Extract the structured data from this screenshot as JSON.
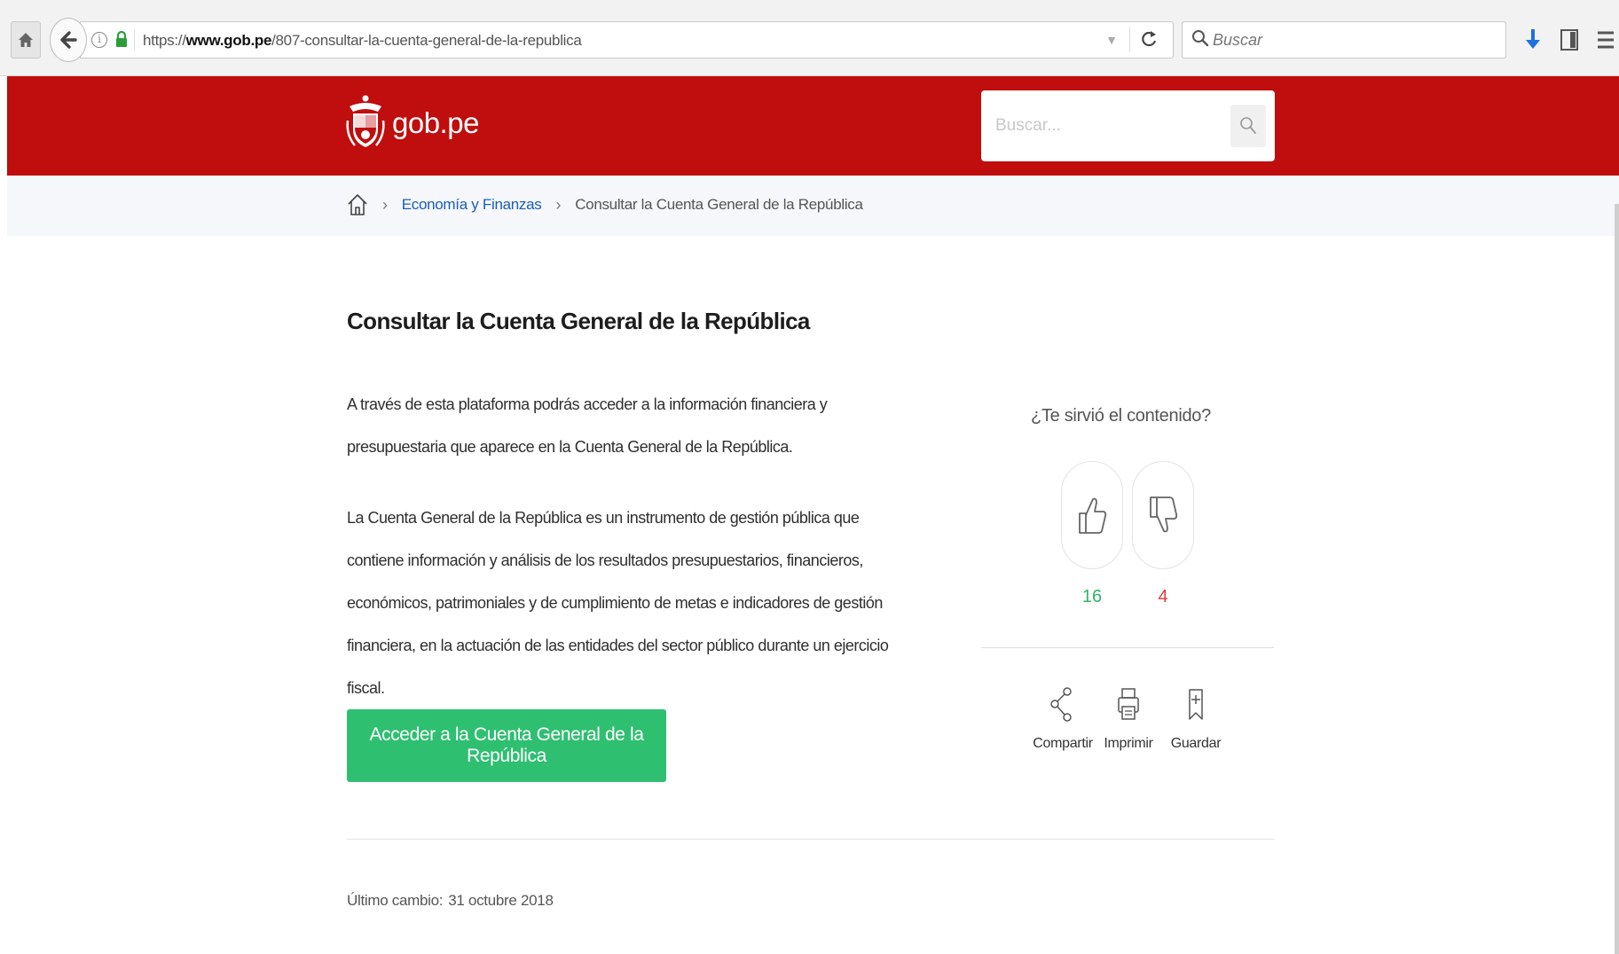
{
  "browser": {
    "url_prefix": "https://",
    "url_domain": "www.gob.pe",
    "url_path": "/807-consultar-la-cuenta-general-de-la-republica",
    "search_placeholder": "Buscar"
  },
  "header": {
    "logo_text": "gob.pe",
    "search_placeholder": "Buscar..."
  },
  "breadcrumb": {
    "link": "Economía y Finanzas",
    "current": "Consultar la Cuenta General de la República"
  },
  "main": {
    "title": "Consultar la Cuenta General de la República",
    "paragraph1": "A través de esta plataforma podrás acceder a la información financiera y presupuestaria que aparece en la Cuenta General de la República.",
    "paragraph2": "La Cuenta General de la República es un instrumento de gestión pública que contiene información y análisis de los resultados presupuestarios, financieros, económicos, patrimoniales y de cumplimiento de metas e indicadores de gestión financiera, en la actuación de las entidades del sector público durante un ejercicio fiscal.",
    "cta_label": "Acceder a la Cuenta General de la República",
    "last_change_label": "Último cambio:",
    "last_change_date": "31 octubre 2018"
  },
  "feedback": {
    "question": "¿Te sirvió el contenido?",
    "up_count": "16",
    "down_count": "4"
  },
  "actions": {
    "share": "Compartir",
    "print": "Imprimir",
    "save": "Guardar"
  },
  "colors": {
    "header_red": "#c00d0d",
    "cta_green": "#2fbf71",
    "link_blue": "#1a5fb4",
    "up_green": "#2fb36a",
    "down_red": "#d93b3b"
  },
  "icons": [
    "home-icon",
    "back-arrow-icon",
    "info-icon",
    "lock-icon",
    "dropdown-icon",
    "reload-icon",
    "search-icon",
    "download-icon",
    "library-icon",
    "menu-icon",
    "coat-of-arms-icon",
    "thumbs-up-icon",
    "thumbs-down-icon",
    "share-icon",
    "print-icon",
    "bookmark-icon"
  ]
}
